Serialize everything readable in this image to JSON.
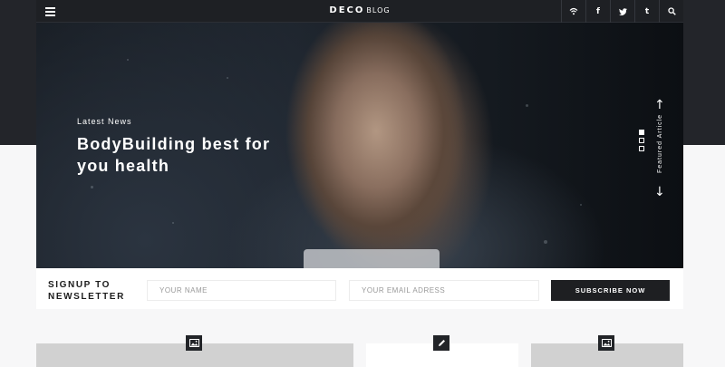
{
  "header": {
    "logo_brand": "DECO",
    "logo_sub": "BLOG",
    "social": [
      {
        "name": "rss-icon",
        "glyph": "⊹"
      },
      {
        "name": "facebook-icon",
        "glyph": "f"
      },
      {
        "name": "twitter-icon",
        "glyph": "✧"
      },
      {
        "name": "tumblr-icon",
        "glyph": "t"
      },
      {
        "name": "search-icon",
        "glyph": "⌕"
      }
    ]
  },
  "hero": {
    "category": "Latest News",
    "title": "BodyBuilding best for you health",
    "featured_label": "Featured Article",
    "slides": 3,
    "active_slide": 1
  },
  "newsletter": {
    "label_line1": "SIGNUP TO",
    "label_line2": "NEWSLETTER",
    "name_placeholder": "YOUR NAME",
    "email_placeholder": "YOUR EMAIL ADRESS",
    "button_label": "SUBSCRIBE NOW"
  },
  "cards": [
    {
      "type": "image",
      "icon": "image-icon"
    },
    {
      "type": "text",
      "icon": "pencil-icon"
    },
    {
      "type": "image",
      "icon": "image-icon"
    }
  ],
  "colors": {
    "header_bg": "#1e2024",
    "accent_dark": "#1e1f22",
    "page_bg": "#f7f7f8"
  }
}
